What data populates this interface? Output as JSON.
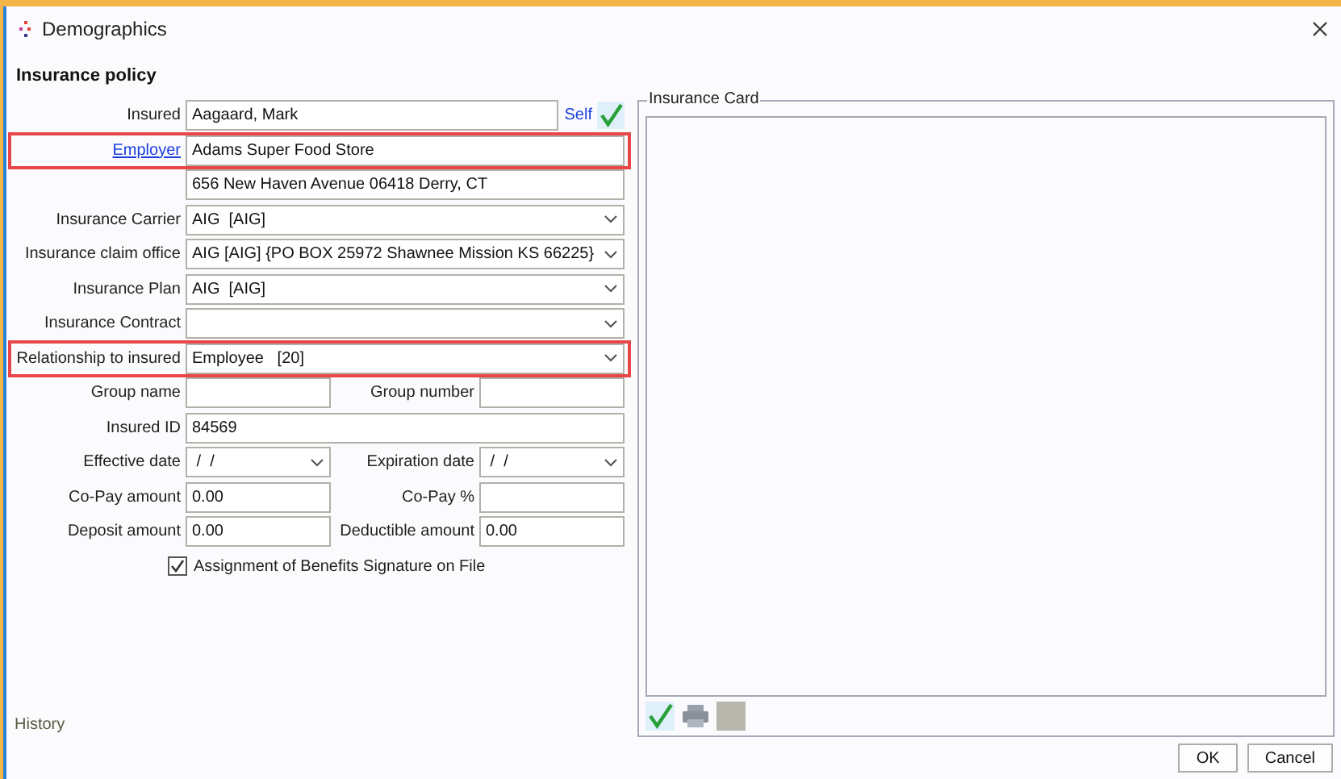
{
  "window": {
    "title": "Demographics"
  },
  "heading": "Insurance policy",
  "rows": [
    {
      "kind": "field",
      "label": "Insured",
      "label_link": false,
      "value": "Aagaard, Mark",
      "link": "Self",
      "highlighted": false
    },
    {
      "kind": "field",
      "label": "Employer",
      "label_link": true,
      "value": "Adams Super Food Store",
      "highlighted": true
    },
    {
      "kind": "field",
      "value": "656 New Haven Avenue 06418 Derry, CT",
      "highlighted": false
    },
    {
      "kind": "select",
      "label": "Insurance Carrier",
      "label_link": false,
      "value": "AIG  [AIG]",
      "highlighted": false
    },
    {
      "kind": "select",
      "label": "Insurance claim office",
      "label_link": false,
      "value": "AIG [AIG] {PO BOX 25972 Shawnee Mission KS 66225}",
      "highlighted": false
    },
    {
      "kind": "select",
      "label": "Insurance Plan",
      "label_link": false,
      "value": "AIG  [AIG]",
      "highlighted": false
    },
    {
      "kind": "select",
      "label": "Insurance Contract",
      "label_link": false,
      "highlighted": false
    },
    {
      "kind": "select",
      "label": "Relationship to insured",
      "label_link": false,
      "value": "Employee   [20]",
      "highlighted": true
    },
    {
      "kind": "pair",
      "highlighted": false,
      "items": [
        {
          "kind": "field",
          "label": "Group name"
        },
        {
          "kind": "field",
          "label": "Group number"
        }
      ]
    },
    {
      "kind": "field",
      "label": "Insured ID",
      "label_link": false,
      "value": "84569",
      "highlighted": false
    },
    {
      "kind": "pair",
      "highlighted": false,
      "items": [
        {
          "kind": "select",
          "label": "Effective date",
          "value": " /  /"
        },
        {
          "kind": "select",
          "label": "Expiration date",
          "value": " /  /"
        }
      ]
    },
    {
      "kind": "pair",
      "highlighted": false,
      "items": [
        {
          "kind": "field",
          "label": "Co-Pay amount",
          "value": "0.00"
        },
        {
          "kind": "field",
          "label": "Co-Pay %"
        }
      ]
    },
    {
      "kind": "pair",
      "highlighted": false,
      "items": [
        {
          "kind": "field",
          "label": "Deposit amount",
          "value": "0.00"
        },
        {
          "kind": "field",
          "label": "Deductible amount",
          "value": "0.00"
        }
      ]
    },
    {
      "kind": "checkbox",
      "label": "Assignment of Benefits Signature on File",
      "checked": true,
      "highlighted": false
    }
  ],
  "card": {
    "title": "Insurance Card"
  },
  "history": "History",
  "buttons": [
    "OK",
    "Cancel"
  ]
}
